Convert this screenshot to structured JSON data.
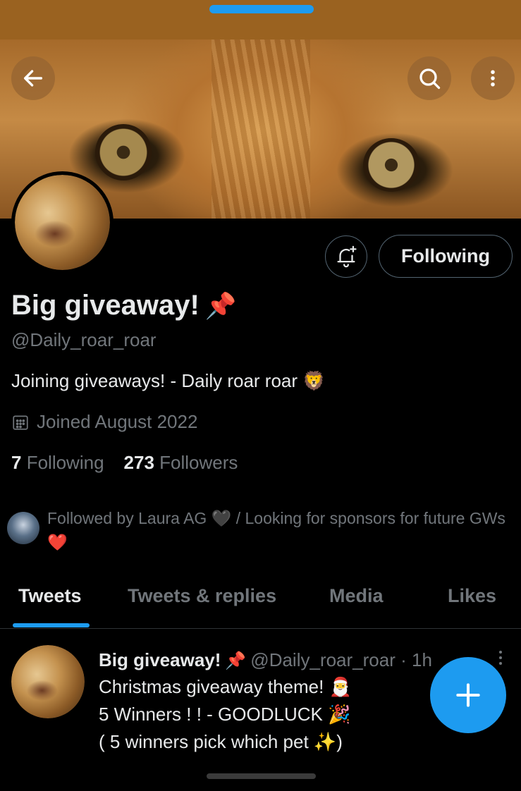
{
  "profile": {
    "name": "Big giveaway!",
    "name_emoji": "📌",
    "handle": "@Daily_roar_roar",
    "bio": "Joining giveaways! - Daily roar roar 🦁",
    "joined": "Joined August 2022",
    "following_count": "7",
    "following_label": "Following",
    "followers_count": "273",
    "followers_label": "Followers",
    "followed_by": "Followed by Laura AG 🖤 / Looking for sponsors for future GWs❤️"
  },
  "actions": {
    "following_button": "Following"
  },
  "tabs": [
    {
      "label": "Tweets",
      "active": true
    },
    {
      "label": "Tweets & replies",
      "active": false
    },
    {
      "label": "Media",
      "active": false
    },
    {
      "label": "Likes",
      "active": false
    }
  ],
  "tweet": {
    "author": "Big giveaway!",
    "author_emoji": "📌",
    "handle_time": "@Daily_roar_roar · 1h",
    "lines": [
      "Christmas giveaway theme! 🎅",
      "5 Winners ! !  - GOODLUCK 🎉",
      "( 5 winners pick which pet  ✨)"
    ]
  },
  "colors": {
    "accent": "#1d9bf0",
    "background": "#000000",
    "status_bar": "#9a6220",
    "secondary_text": "#71767b"
  },
  "icons": [
    "back-arrow-icon",
    "search-icon",
    "more-vertical-icon",
    "bell-plus-icon",
    "calendar-icon",
    "compose-plus-icon",
    "tweet-more-icon"
  ]
}
